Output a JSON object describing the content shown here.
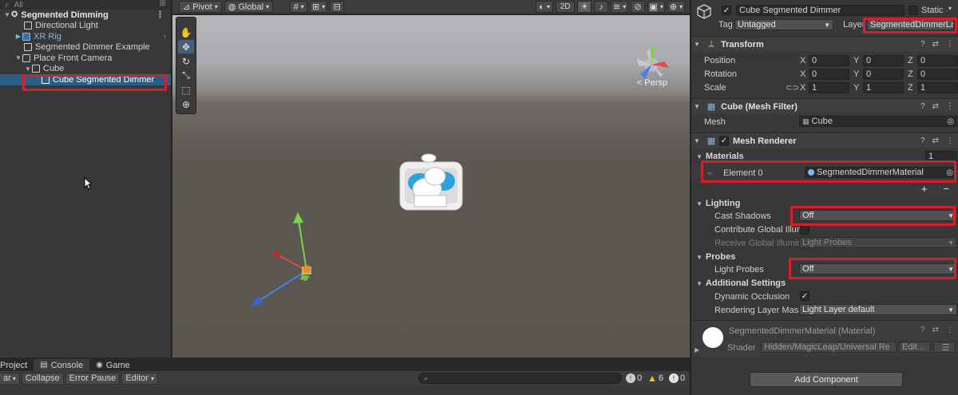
{
  "hierarchy": {
    "search_placeholder": "All",
    "add_symbol": "⊞",
    "scene_name": "Segmented Dimming",
    "items": [
      {
        "label": "Directional Light"
      },
      {
        "label": "XR Rig"
      },
      {
        "label": "Segmented Dimmer Example"
      },
      {
        "label": "Place Front Camera"
      },
      {
        "label": "Cube"
      },
      {
        "label": "Cube Segmented Dimmer"
      }
    ]
  },
  "scene_toolbar": {
    "pivot": "Pivot",
    "global": "Global",
    "mode_2d": "2D",
    "icons": [
      "hand-tool-icon",
      "move-tool-icon",
      "rotate-tool-icon",
      "scale-tool-icon",
      "rect-tool-icon",
      "transform-tool-icon"
    ]
  },
  "viewport": {
    "projection_label": "< Persp"
  },
  "bottom": {
    "tabs": [
      {
        "label": "Project"
      },
      {
        "label": "Console"
      },
      {
        "label": "Game"
      }
    ],
    "clear": "ar",
    "collapse": "Collapse",
    "error_pause": "Error Pause",
    "editor": "Editor",
    "counts": {
      "info": "0",
      "warn": "6",
      "error": "0"
    }
  },
  "inspector": {
    "object_name": "Cube Segmented Dimmer",
    "static_label": "Static",
    "tag_label": "Tag",
    "tag_value": "Untagged",
    "layer_label": "Layer",
    "layer_value": "SegmentedDimmerLa",
    "transform": {
      "title": "Transform",
      "position_label": "Position",
      "rotation_label": "Rotation",
      "scale_label": "Scale",
      "position": {
        "x": "0",
        "y": "0",
        "z": "0"
      },
      "rotation": {
        "x": "0",
        "y": "0",
        "z": "0"
      },
      "scale": {
        "x": "1",
        "y": "1",
        "z": "1"
      },
      "axis_x": "X",
      "axis_y": "Y",
      "axis_z": "Z"
    },
    "mesh_filter": {
      "title": "Cube (Mesh Filter)",
      "mesh_label": "Mesh",
      "mesh_value": "Cube"
    },
    "mesh_renderer": {
      "title": "Mesh Renderer",
      "materials_label": "Materials",
      "materials_count": "1",
      "element_label": "Element 0",
      "element_value": "SegmentedDimmerMaterial",
      "plus": "+",
      "minus": "−",
      "lighting_label": "Lighting",
      "cast_shadows_label": "Cast Shadows",
      "cast_shadows_value": "Off",
      "contribute_gi_label": "Contribute Global Illum",
      "receive_gi_label": "Receive Global Illumin",
      "receive_gi_value": "Light Probes",
      "probes_label": "Probes",
      "light_probes_label": "Light Probes",
      "light_probes_value": "Off",
      "additional_label": "Additional Settings",
      "dynamic_occlusion_label": "Dynamic Occlusion",
      "rendering_layer_label": "Rendering Layer Mask",
      "rendering_layer_value": "Light Layer default"
    },
    "material": {
      "title": "SegmentedDimmerMaterial (Material)",
      "shader_label": "Shader",
      "shader_value": "Hidden/MagicLeap/Universal Re",
      "edit": "Edit..."
    },
    "add_component": "Add Component"
  },
  "colors": {
    "highlight_red": "#d51f2a",
    "selection_blue": "#2c5d87",
    "prefab_blue": "#7fb7ee"
  }
}
